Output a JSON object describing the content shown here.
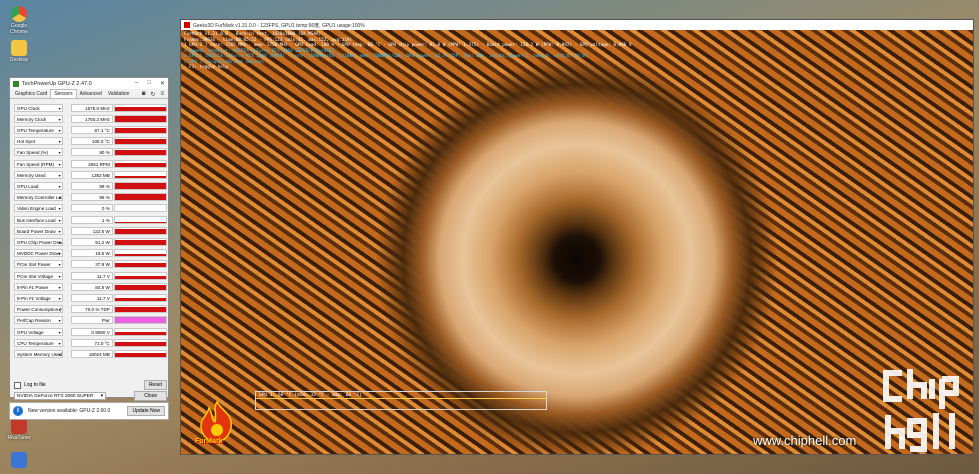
{
  "desktop": {
    "icons": [
      {
        "label": "Google Chrome",
        "color": "#e9462d"
      },
      {
        "label": "Desktop",
        "color": "#f4c542"
      },
      {
        "label": "RivaTuner",
        "color": "#c0392b"
      },
      {
        "label": "GPU-Z",
        "color": "#3a77d4"
      }
    ]
  },
  "gpuz": {
    "title": "TechPowerUp GPU-Z 2.47.0",
    "tabs": [
      "Graphics Card",
      "Sensors",
      "Advanced",
      "Validation"
    ],
    "active_tab": "Sensors",
    "sensors": [
      {
        "name": "GPU Clock",
        "value": "1575.0 MHz",
        "fill": 0.55,
        "color": "#d01010"
      },
      {
        "name": "Memory Clock",
        "value": "1750.2 MHz",
        "fill": 0.95,
        "color": "#d01010"
      },
      {
        "name": "GPU Temperature",
        "value": "67.1 °C",
        "fill": 0.9,
        "color": "#d01010"
      },
      {
        "name": "Hot Spot",
        "value": "105.0 °C",
        "fill": 0.92,
        "color": "#d01010"
      },
      {
        "name": "Fan Speed (%)",
        "value": "80 %",
        "fill": 0.85,
        "color": "#d01010"
      },
      {
        "name": "Fan Speed (RPM)",
        "value": "2651 RPM",
        "fill": 0.6,
        "color": "#d01010"
      },
      {
        "name": "Memory Used",
        "value": "1382 MB",
        "fill": 0.3,
        "color": "#d01010"
      },
      {
        "name": "GPU Load",
        "value": "99 %",
        "fill": 0.98,
        "color": "#d01010"
      },
      {
        "name": "Memory Controller Load",
        "value": "96 %",
        "fill": 0.95,
        "color": "#d01010"
      },
      {
        "name": "Video Engine Load",
        "value": "0 %",
        "fill": 0.0,
        "color": "#d01010"
      },
      {
        "name": "Bus Interface Load",
        "value": "1 %",
        "fill": 0.05,
        "color": "#d01010"
      },
      {
        "name": "Board Power Draw",
        "value": "122.5 W",
        "fill": 0.8,
        "color": "#d01010"
      },
      {
        "name": "GPU Chip Power Draw",
        "value": "91.2 W",
        "fill": 0.8,
        "color": "#d01010"
      },
      {
        "name": "MVDDC Power Draw",
        "value": "19.6 W",
        "fill": 0.3,
        "color": "#d01010"
      },
      {
        "name": "PCIe Slot Power",
        "value": "37.9 W",
        "fill": 0.7,
        "color": "#d01010"
      },
      {
        "name": "PCIe Slot Voltage",
        "value": "11.7 V",
        "fill": 0.5,
        "color": "#d01010"
      },
      {
        "name": "8-Pin #1 Power",
        "value": "84.5 W",
        "fill": 0.8,
        "color": "#d01010"
      },
      {
        "name": "8-Pin #1 Voltage",
        "value": "11.7 V",
        "fill": 0.5,
        "color": "#d01010"
      },
      {
        "name": "Power Consumption (%)",
        "value": "70.0 % TDP",
        "fill": 0.85,
        "color": "#d01010"
      },
      {
        "name": "PerfCap Reason",
        "value": "Pwr",
        "fill": 1.0,
        "color": "#ea62e0"
      },
      {
        "name": "GPU Voltage",
        "value": "0.9060 V",
        "fill": 0.5,
        "color": "#d01010"
      },
      {
        "name": "CPU Temperature",
        "value": "71.0 °C",
        "fill": 0.7,
        "color": "#d01010"
      },
      {
        "name": "System Memory Used",
        "value": "18024 MB",
        "fill": 0.6,
        "color": "#d01010"
      }
    ],
    "log_label": "Log to file",
    "reset_label": "Reset",
    "gpu_select": "NVIDIA GeForce RTX 2060 SUPER",
    "close_label": "Close"
  },
  "notification": {
    "message": "New version available: GPU-Z 2.60.0",
    "button": "Update Now"
  },
  "furmark": {
    "title": "Geeks3D FurMark v1.31.0.0 - 123FPS, GPU1 temp:66度, GPU1 usage:100%",
    "overlay": [
      {
        "text": "FurMark v1.31.0.0 - Burn-in test, 1920x1080 (0X MSAA)",
        "color": "#ffffff"
      },
      {
        "text": "Frames:39936 - time:00:05:52 - FPS:123 (min:35, max:152, avg:119)",
        "color": "#ffffff"
      },
      {
        "text": "[ GPU-Z ] core: 1565 MHz - mem: 1750 MHz - GPU load: 100 % - GPU temp: 66 °C - GPU chip power: 91.0 W (PPW: 1.375) - Board power: 126.2 W (PPW: 0.992) - GPU voltage: 0.906 V",
        "color": "#ffffff"
      },
      {
        "text": "> OpenGL renderer: NVIDIA GeForce RTX 2060 SUPER/PCIe/SSE2",
        "color": "#33ccff"
      },
      {
        "text": "> GPU 1 (NVIDIA GeForce RTX 2060 SUPER) - core: 1590MHz/66 °C/100%, mem: 7000MHz/10%, GPU power: 66.7% TDP, fan: 80%, limits:[power:1, temp:0, volt:0, OV:0]",
        "color": "#33ccff"
      },
      {
        "text": "> GPU 2 (GraphicsDriver Device)",
        "color": "#33ccff"
      },
      {
        "text": "- F1: toggle help",
        "color": "#ffffff"
      }
    ],
    "temp_graph": "GPU 1: 66 °C (min: 33 °C - max: 66 °C)",
    "logo_text": "FurMark"
  },
  "watermark": "www.chiphell.com",
  "chiphell_logo": "chip hell"
}
